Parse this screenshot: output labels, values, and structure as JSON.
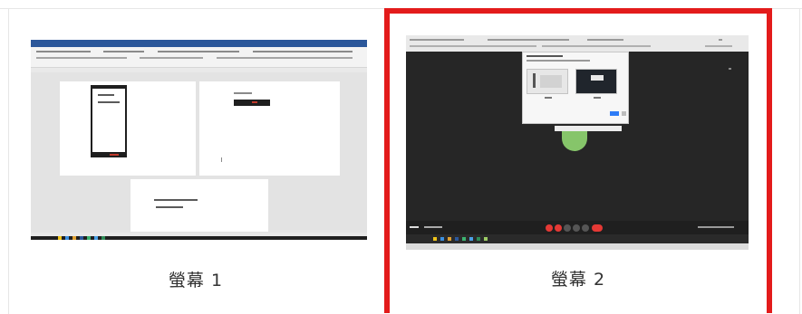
{
  "screens": [
    {
      "id": "screen-1",
      "label": "螢幕 1",
      "selected": false
    },
    {
      "id": "screen-2",
      "label": "螢幕 2",
      "selected": true
    }
  ],
  "colors": {
    "selection_border": "#e31b1b",
    "word_blue": "#2b579a",
    "meeting_dark": "#262626",
    "avatar_green": "#86c56a"
  }
}
